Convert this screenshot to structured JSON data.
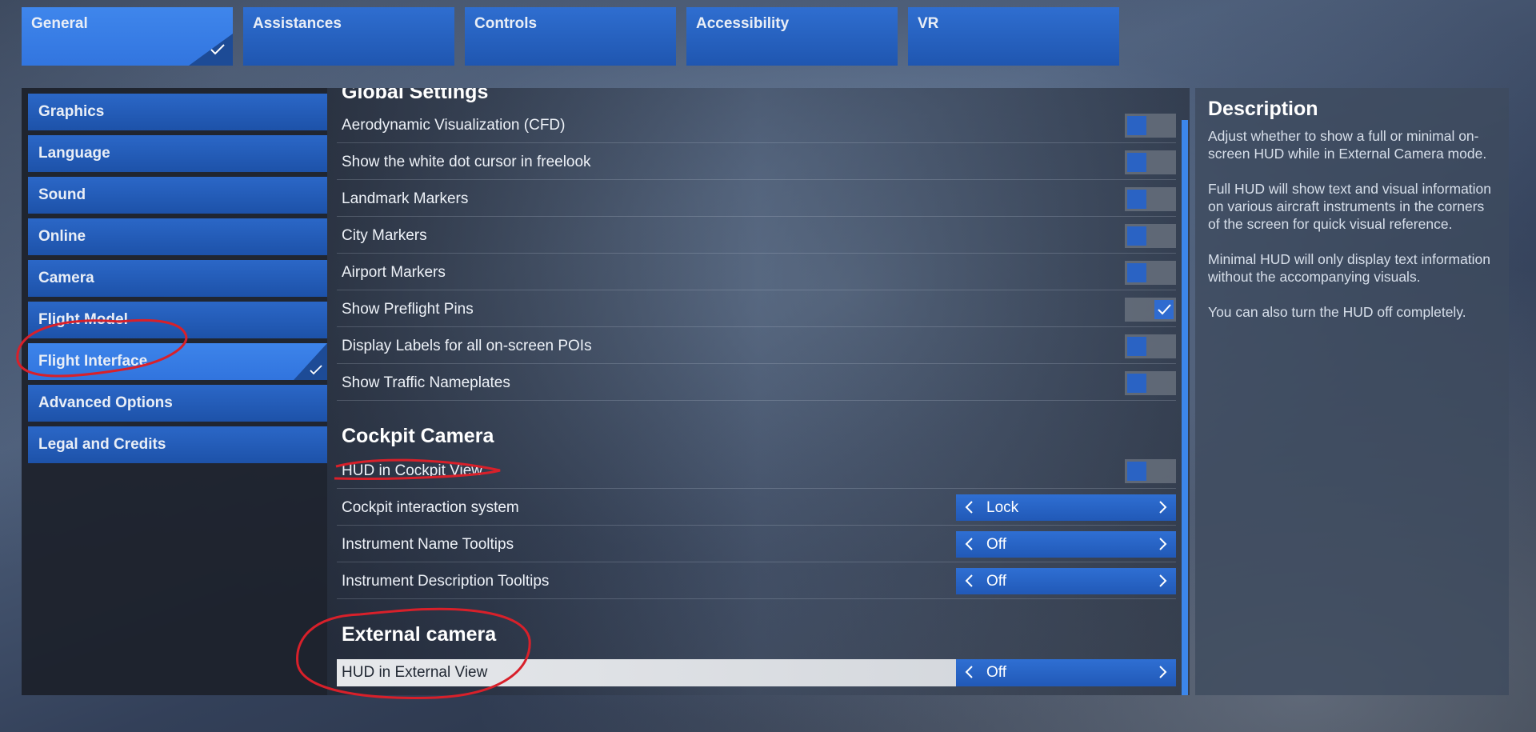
{
  "tabs": [
    {
      "label": "General",
      "active": true
    },
    {
      "label": "Assistances",
      "active": false
    },
    {
      "label": "Controls",
      "active": false
    },
    {
      "label": "Accessibility",
      "active": false
    },
    {
      "label": "VR",
      "active": false
    }
  ],
  "categories": [
    {
      "label": "Graphics"
    },
    {
      "label": "Language"
    },
    {
      "label": "Sound"
    },
    {
      "label": "Online"
    },
    {
      "label": "Camera"
    },
    {
      "label": "Flight Model"
    },
    {
      "label": "Flight Interface",
      "active": true
    },
    {
      "label": "Advanced Options"
    },
    {
      "label": "Legal and Credits"
    }
  ],
  "global_settings": {
    "heading": "Global Settings",
    "rows": [
      {
        "label": "Aerodynamic Visualization (CFD)",
        "control": "toggle",
        "on": false
      },
      {
        "label": "Show the white dot cursor in freelook",
        "control": "toggle",
        "on": false
      },
      {
        "label": "Landmark Markers",
        "control": "toggle",
        "on": false
      },
      {
        "label": "City Markers",
        "control": "toggle",
        "on": false
      },
      {
        "label": "Airport Markers",
        "control": "toggle",
        "on": false
      },
      {
        "label": "Show Preflight Pins",
        "control": "toggle",
        "on": true
      },
      {
        "label": "Display Labels for all on-screen POIs",
        "control": "toggle",
        "on": false
      },
      {
        "label": "Show Traffic Nameplates",
        "control": "toggle",
        "on": false
      }
    ]
  },
  "cockpit_camera": {
    "heading": "Cockpit Camera",
    "rows": [
      {
        "label": "HUD in Cockpit View",
        "control": "toggle",
        "on": false
      },
      {
        "label": "Cockpit interaction system",
        "control": "selector",
        "value": "Lock"
      },
      {
        "label": "Instrument Name Tooltips",
        "control": "selector",
        "value": "Off"
      },
      {
        "label": "Instrument Description Tooltips",
        "control": "selector",
        "value": "Off"
      }
    ]
  },
  "external_camera": {
    "heading": "External camera",
    "rows": [
      {
        "label": "HUD in External View",
        "control": "selector",
        "value": "Off",
        "selected": true
      }
    ]
  },
  "description": {
    "title": "Description",
    "paragraphs": [
      "Adjust whether to show a full or minimal on-screen HUD while in External Camera mode.",
      "Full HUD will show text and visual information on various aircraft instruments in the corners of the screen for quick visual reference.",
      "Minimal HUD will only display text information without the accompanying visuals.",
      "You can also turn the HUD off completely."
    ]
  },
  "icons": {
    "check": "checkmark-icon",
    "arrow_left": "chevron-left-icon",
    "arrow_right": "chevron-right-icon"
  },
  "colors": {
    "accent": "#3275df",
    "tab_blue": "#1f56b0",
    "annotation_red": "#d8202a"
  }
}
